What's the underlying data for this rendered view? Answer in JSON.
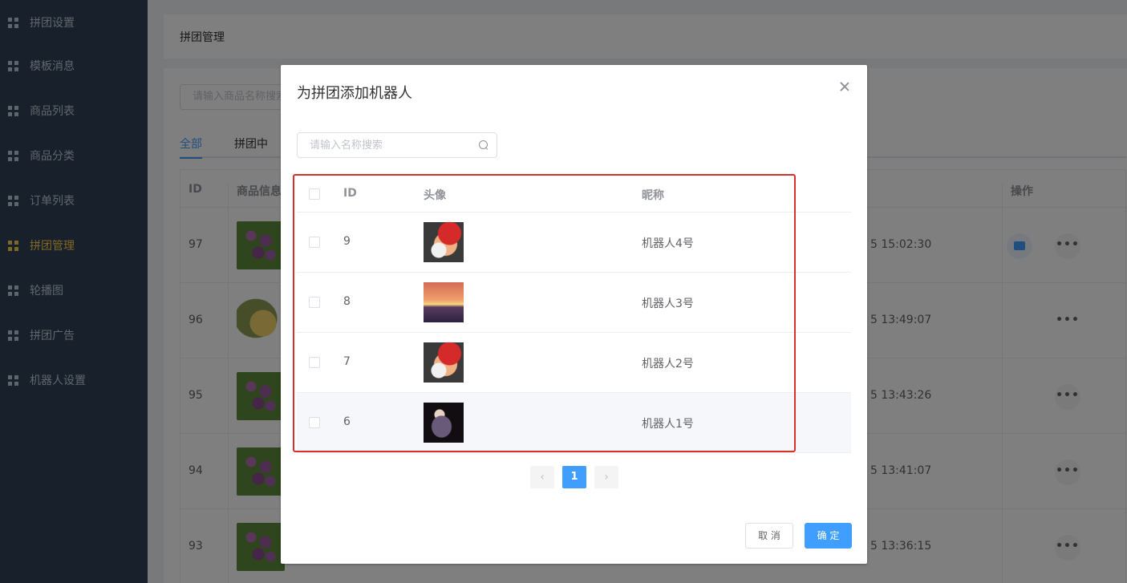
{
  "sidebar": {
    "items": [
      {
        "label": "拼团设置"
      },
      {
        "label": "模板消息"
      },
      {
        "label": "商品列表"
      },
      {
        "label": "商品分类"
      },
      {
        "label": "订单列表"
      },
      {
        "label": "拼团管理",
        "active": true
      },
      {
        "label": "轮播图"
      },
      {
        "label": "拼团广告"
      },
      {
        "label": "机器人设置"
      }
    ]
  },
  "page": {
    "title": "拼团管理",
    "search_placeholder": "请输入商品名称搜索",
    "tabs": [
      {
        "label": "全部",
        "active": true
      },
      {
        "label": "拼团中"
      }
    ],
    "table": {
      "columns": [
        "ID",
        "商品信息",
        "操作"
      ],
      "rows": [
        {
          "id": "97",
          "time": "5 15:02:30"
        },
        {
          "id": "96",
          "time": "5 13:49:07"
        },
        {
          "id": "95",
          "time": "5 13:43:26"
        },
        {
          "id": "94",
          "time": "5 13:41:07"
        },
        {
          "id": "93",
          "time": "5 13:36:15"
        }
      ]
    }
  },
  "dialog": {
    "title": "为拼团添加机器人",
    "search_placeholder": "请输入名称搜索",
    "columns": {
      "id": "ID",
      "avatar": "头像",
      "nickname": "昵称"
    },
    "rows": [
      {
        "id": "9",
        "nickname": "机器人4号",
        "avatar": "mario"
      },
      {
        "id": "8",
        "nickname": "机器人3号",
        "avatar": "sunset"
      },
      {
        "id": "7",
        "nickname": "机器人2号",
        "avatar": "mario"
      },
      {
        "id": "6",
        "nickname": "机器人1号",
        "avatar": "dark-portrait"
      }
    ],
    "pagination": {
      "current": "1",
      "prev_icon": "chevron-left-icon",
      "next_icon": "chevron-right-icon"
    },
    "cancel_label": "取 消",
    "confirm_label": "确 定"
  },
  "colors": {
    "sidebar_bg": "#304156",
    "sidebar_active": "#ffd04b",
    "primary": "#409eff",
    "highlight_border": "#d9302a"
  }
}
